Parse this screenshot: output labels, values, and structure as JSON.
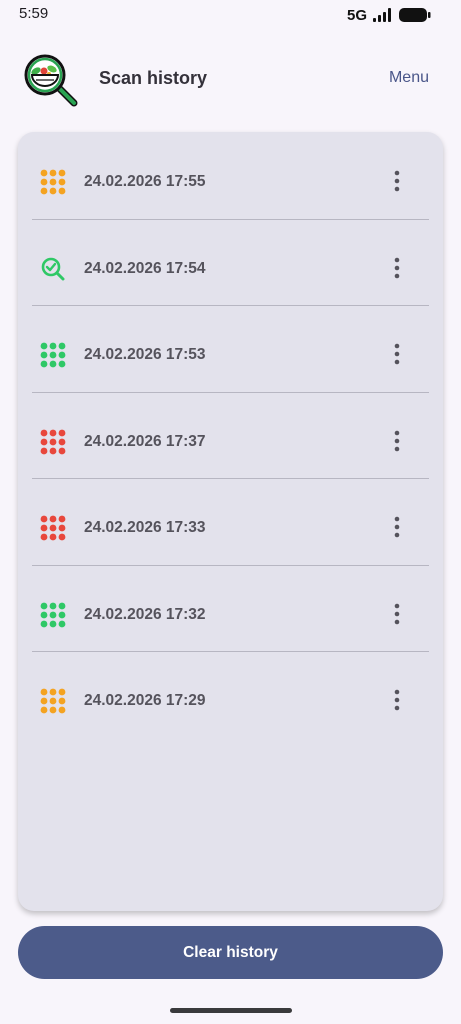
{
  "status_bar": {
    "time": "5:59",
    "network": "5G"
  },
  "header": {
    "title": "Scan history",
    "menu_label": "Menu",
    "logo_icon": "salad-magnifier-logo"
  },
  "history": {
    "items": [
      {
        "date": "24.02.2026 17:55",
        "icon": "grid-dots-icon",
        "color": "#f4a321"
      },
      {
        "date": "24.02.2026 17:54",
        "icon": "search-check-icon",
        "color": "#2fc866"
      },
      {
        "date": "24.02.2026 17:53",
        "icon": "grid-dots-icon",
        "color": "#2fc866"
      },
      {
        "date": "24.02.2026 17:37",
        "icon": "grid-dots-icon",
        "color": "#e8473c"
      },
      {
        "date": "24.02.2026 17:33",
        "icon": "grid-dots-icon",
        "color": "#e8473c"
      },
      {
        "date": "24.02.2026 17:32",
        "icon": "grid-dots-icon",
        "color": "#2fc866"
      },
      {
        "date": "24.02.2026 17:29",
        "icon": "grid-dots-icon",
        "color": "#f4a321"
      }
    ],
    "more_icon": "more-vert-icon"
  },
  "footer": {
    "clear_label": "Clear history",
    "button_color": "#4c5b8a"
  }
}
